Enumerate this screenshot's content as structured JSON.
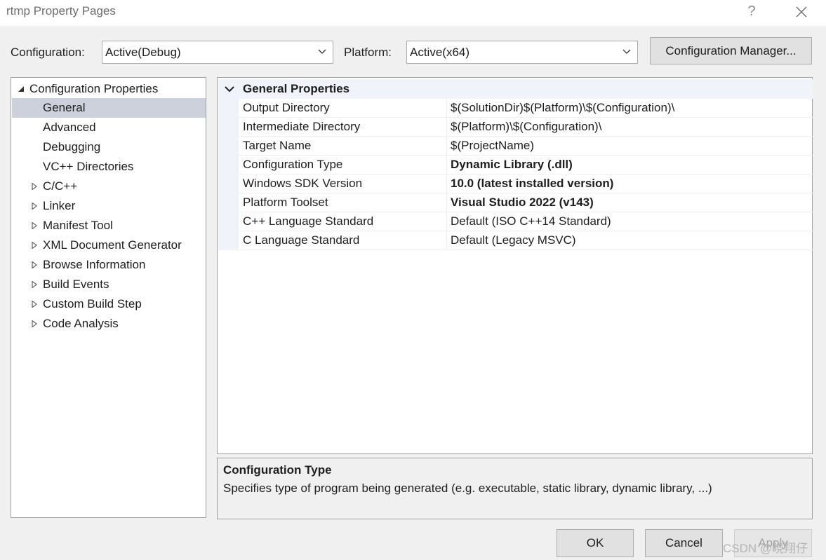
{
  "window": {
    "title": "rtmp Property Pages",
    "help_label": "?"
  },
  "toolbar": {
    "configuration_label": "Configuration:",
    "configuration_value": "Active(Debug)",
    "platform_label": "Platform:",
    "platform_value": "Active(x64)",
    "config_manager_label": "Configuration Manager..."
  },
  "tree": {
    "root": {
      "label": "Configuration Properties",
      "expanded": true
    },
    "items": [
      {
        "label": "General",
        "selected": true,
        "expandable": false
      },
      {
        "label": "Advanced",
        "selected": false,
        "expandable": false
      },
      {
        "label": "Debugging",
        "selected": false,
        "expandable": false
      },
      {
        "label": "VC++ Directories",
        "selected": false,
        "expandable": false
      },
      {
        "label": "C/C++",
        "selected": false,
        "expandable": true
      },
      {
        "label": "Linker",
        "selected": false,
        "expandable": true
      },
      {
        "label": "Manifest Tool",
        "selected": false,
        "expandable": true
      },
      {
        "label": "XML Document Generator",
        "selected": false,
        "expandable": true
      },
      {
        "label": "Browse Information",
        "selected": false,
        "expandable": true
      },
      {
        "label": "Build Events",
        "selected": false,
        "expandable": true
      },
      {
        "label": "Custom Build Step",
        "selected": false,
        "expandable": true
      },
      {
        "label": "Code Analysis",
        "selected": false,
        "expandable": true
      }
    ]
  },
  "grid": {
    "section_title": "General Properties",
    "rows": [
      {
        "name": "Output Directory",
        "value": "$(SolutionDir)$(Platform)\\$(Configuration)\\",
        "bold": false
      },
      {
        "name": "Intermediate Directory",
        "value": "$(Platform)\\$(Configuration)\\",
        "bold": false
      },
      {
        "name": "Target Name",
        "value": "$(ProjectName)",
        "bold": false
      },
      {
        "name": "Configuration Type",
        "value": "Dynamic Library (.dll)",
        "bold": true
      },
      {
        "name": "Windows SDK Version",
        "value": "10.0 (latest installed version)",
        "bold": true
      },
      {
        "name": "Platform Toolset",
        "value": "Visual Studio 2022 (v143)",
        "bold": true
      },
      {
        "name": "C++ Language Standard",
        "value": "Default (ISO C++14 Standard)",
        "bold": false
      },
      {
        "name": "C Language Standard",
        "value": "Default (Legacy MSVC)",
        "bold": false
      }
    ]
  },
  "description": {
    "title": "Configuration Type",
    "text": "Specifies type of program being generated (e.g. executable, static library, dynamic library, ...)"
  },
  "buttons": {
    "ok": "OK",
    "cancel": "Cancel",
    "apply": "Apply"
  },
  "watermark": "CSDN @晓翔仔",
  "colors": {
    "selection": "#cdd1dc",
    "header_band": "#f0f3f9",
    "border": "#a0a0a0"
  }
}
